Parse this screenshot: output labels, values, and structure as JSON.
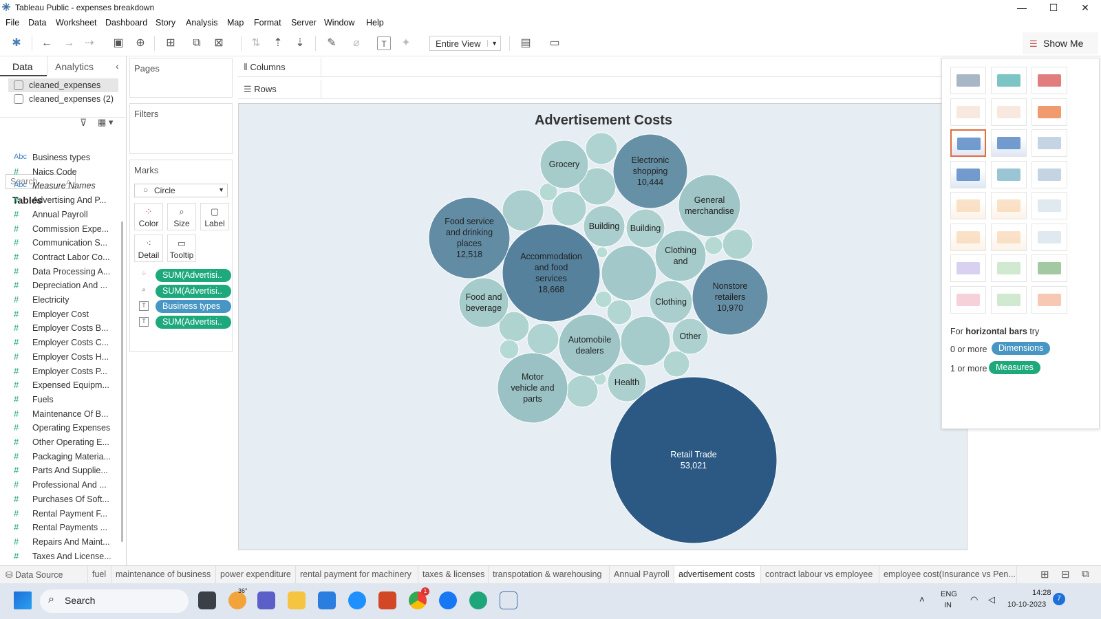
{
  "window": {
    "title": "Tableau Public - expenses breakdown",
    "minimize": "—",
    "maximize": "☐",
    "close": "✕"
  },
  "menu": [
    "File",
    "Data",
    "Worksheet",
    "Dashboard",
    "Story",
    "Analysis",
    "Map",
    "Format",
    "Server",
    "Window",
    "Help"
  ],
  "toolbar": {
    "fit_value": "Entire View",
    "show_me_label": "Show Me"
  },
  "data_pane": {
    "tab_data": "Data",
    "tab_analytics": "Analytics",
    "sources": [
      "cleaned_expenses",
      "cleaned_expenses (2)"
    ],
    "search_placeholder": "Search",
    "tables_heading": "Tables",
    "fields": [
      {
        "type": "Abc",
        "name": "Business types"
      },
      {
        "type": "#",
        "name": "Naics Code"
      },
      {
        "type": "Abc",
        "name": "Measure Names"
      },
      {
        "type": "#",
        "name": "Advertising And P..."
      },
      {
        "type": "#",
        "name": "Annual Payroll"
      },
      {
        "type": "#",
        "name": "Commission Expe..."
      },
      {
        "type": "#",
        "name": "Communication S..."
      },
      {
        "type": "#",
        "name": "Contract Labor Co..."
      },
      {
        "type": "#",
        "name": "Data Processing A..."
      },
      {
        "type": "#",
        "name": "Depreciation And ..."
      },
      {
        "type": "#",
        "name": "Electricity"
      },
      {
        "type": "#",
        "name": "Employer Cost"
      },
      {
        "type": "#",
        "name": "Employer Costs B..."
      },
      {
        "type": "#",
        "name": "Employer Costs C..."
      },
      {
        "type": "#",
        "name": "Employer Costs H..."
      },
      {
        "type": "#",
        "name": "Employer Costs P..."
      },
      {
        "type": "#",
        "name": "Expensed Equipm..."
      },
      {
        "type": "#",
        "name": "Fuels"
      },
      {
        "type": "#",
        "name": "Maintenance Of B..."
      },
      {
        "type": "#",
        "name": "Operating Expenses"
      },
      {
        "type": "#",
        "name": "Other Operating E..."
      },
      {
        "type": "#",
        "name": "Packaging Materia..."
      },
      {
        "type": "#",
        "name": "Parts And Supplie..."
      },
      {
        "type": "#",
        "name": "Professional And ..."
      },
      {
        "type": "#",
        "name": "Purchases Of Soft..."
      },
      {
        "type": "#",
        "name": "Rental Payment F..."
      },
      {
        "type": "#",
        "name": "Rental Payments ..."
      },
      {
        "type": "#",
        "name": "Repairs And Maint..."
      },
      {
        "type": "#",
        "name": "Taxes And License..."
      }
    ]
  },
  "cards": {
    "pages": "Pages",
    "filters": "Filters",
    "marks": "Marks",
    "mark_type": "Circle",
    "mark_buttons": [
      "Color",
      "Size",
      "Label",
      "Detail",
      "Tooltip"
    ],
    "pills": [
      {
        "label": "SUM(Advertisi..",
        "kind": "measure",
        "icon": "color"
      },
      {
        "label": "SUM(Advertisi..",
        "kind": "measure",
        "icon": "size"
      },
      {
        "label": "Business types",
        "kind": "dimension",
        "icon": "label"
      },
      {
        "label": "SUM(Advertisi..",
        "kind": "measure",
        "icon": "label"
      }
    ]
  },
  "shelves": {
    "columns": "Columns",
    "rows": "Rows"
  },
  "chart_data": {
    "type": "bubble",
    "title": "Advertisement Costs",
    "bubbles": [
      {
        "label": "Retail Trade",
        "value": "53,021"
      },
      {
        "label": "Accommodation and food services",
        "value": "18,668"
      },
      {
        "label": "Food service and drinking places",
        "value": "12,518"
      },
      {
        "label": "Nonstore retailers",
        "value": "10,970"
      },
      {
        "label": "Electronic shopping",
        "value": "10,444"
      },
      {
        "label": "General merchandise",
        "value": ""
      },
      {
        "label": "Grocery",
        "value": ""
      },
      {
        "label": "Building",
        "value": ""
      },
      {
        "label": "Building",
        "value": ""
      },
      {
        "label": "Clothing and",
        "value": ""
      },
      {
        "label": "Clothing",
        "value": ""
      },
      {
        "label": "Food and beverage",
        "value": ""
      },
      {
        "label": "Automobile dealers",
        "value": ""
      },
      {
        "label": "Motor vehicle and parts",
        "value": ""
      },
      {
        "label": "Health",
        "value": ""
      },
      {
        "label": "Other",
        "value": ""
      }
    ],
    "color_min": "#b9ddd6",
    "color_max": "#2b5984"
  },
  "show_me": {
    "hint_prefix": "For",
    "hint_bold": "horizontal bars",
    "hint_suffix": "try",
    "dim_prefix": "0 or more",
    "dim_pill": "Dimensions",
    "meas_prefix": "1 or more",
    "meas_pill": "Measures"
  },
  "sheet_tabs": {
    "data_source": "Data Source",
    "tabs": [
      "fuel",
      "maintenance of business",
      "power expenditure",
      "rental payment for machinery",
      "taxes & licenses",
      "transpotation & warehousing",
      "Annual Payroll",
      "advertisement costs",
      "contract labour vs employee",
      "employee cost(Insurance vs Pen..."
    ],
    "active": "advertisement costs"
  },
  "taskbar": {
    "search": "Search",
    "weather": "36°",
    "lang": "ENG",
    "region": "IN",
    "time": "14:28",
    "date": "10-10-2023",
    "notif": "7",
    "chrome_badge": "1"
  }
}
